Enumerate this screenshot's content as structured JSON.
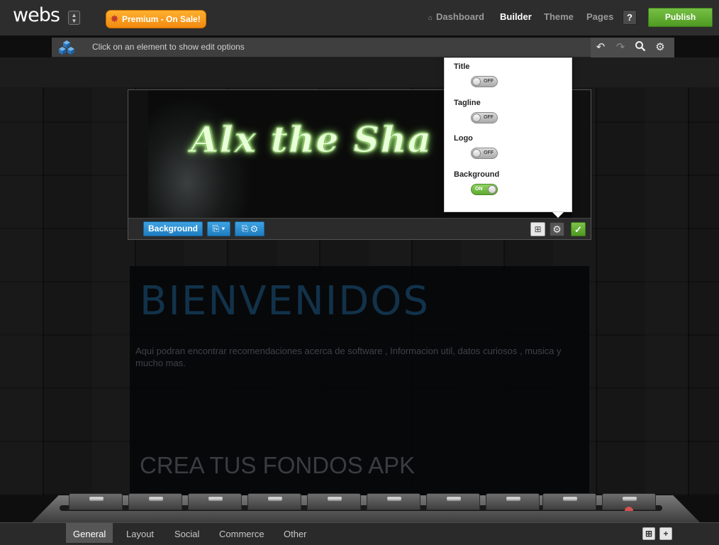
{
  "topnav": {
    "logo": "webs",
    "premium_label": "Premium - On Sale!",
    "dashboard": "Dashboard",
    "builder": "Builder",
    "theme": "Theme",
    "pages": "Pages",
    "help": "?",
    "publish": "Publish"
  },
  "editbar": {
    "hint": "Click on an element to show edit options",
    "tools": [
      "undo-icon",
      "redo-icon",
      "search-icon",
      "gear-icon"
    ]
  },
  "header": {
    "title": "Alx the Sha",
    "background_button": "Background"
  },
  "settings_popover": {
    "items": [
      {
        "label": "Title",
        "state": "OFF"
      },
      {
        "label": "Tagline",
        "state": "OFF"
      },
      {
        "label": "Logo",
        "state": "OFF"
      },
      {
        "label": "Background",
        "state": "ON"
      }
    ]
  },
  "content": {
    "welcome": "BIENVENIDOS",
    "intro": "Aqui podran encontrar recomendaciones acerca de software , Informacion util, datos curiosos , musica y mucho mas.",
    "heading2": "CREA TUS FONDOS APK"
  },
  "bottom_tabs": [
    "General",
    "Layout",
    "Social",
    "Commerce",
    "Other"
  ],
  "colors": {
    "publish": "#5aa52a",
    "premium": "#f5a020",
    "accent_blue": "#2a8fd4"
  }
}
